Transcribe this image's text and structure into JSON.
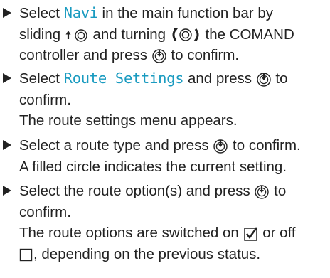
{
  "steps": [
    {
      "line1": {
        "pre": "Select ",
        "hl": "Navi",
        "post": " in the main function bar by"
      },
      "line2": {
        "pre": "sliding ",
        "mid": " and turning ",
        "post": " the COMAND"
      },
      "line3": {
        "pre": "controller and press ",
        "post": " to confirm."
      }
    },
    {
      "line1": {
        "pre": "Select ",
        "hl": "Route Settings",
        "post": " and press ",
        "post2": " to"
      },
      "line2": "confirm.",
      "result": "The route settings menu appears."
    },
    {
      "line1": {
        "pre": "Select a route type and press ",
        "post": " to confirm."
      },
      "result": "A filled circle indicates the current setting."
    },
    {
      "line1": {
        "pre": "Select the route option(s) and press ",
        "post": " to"
      },
      "line2": "confirm.",
      "result1": {
        "pre": "The route options are switched on ",
        "post": " or off"
      },
      "result2": {
        "post": ", depending on the previous status."
      }
    }
  ],
  "icons": {
    "slide": "slide-controller-icon",
    "turn": "turn-controller-icon",
    "press": "press-controller-icon",
    "checkbox_on": "checkbox-checked-icon",
    "checkbox_off": "checkbox-unchecked-icon"
  },
  "colors": {
    "text": "#222222",
    "highlight": "#1a9bc0"
  }
}
